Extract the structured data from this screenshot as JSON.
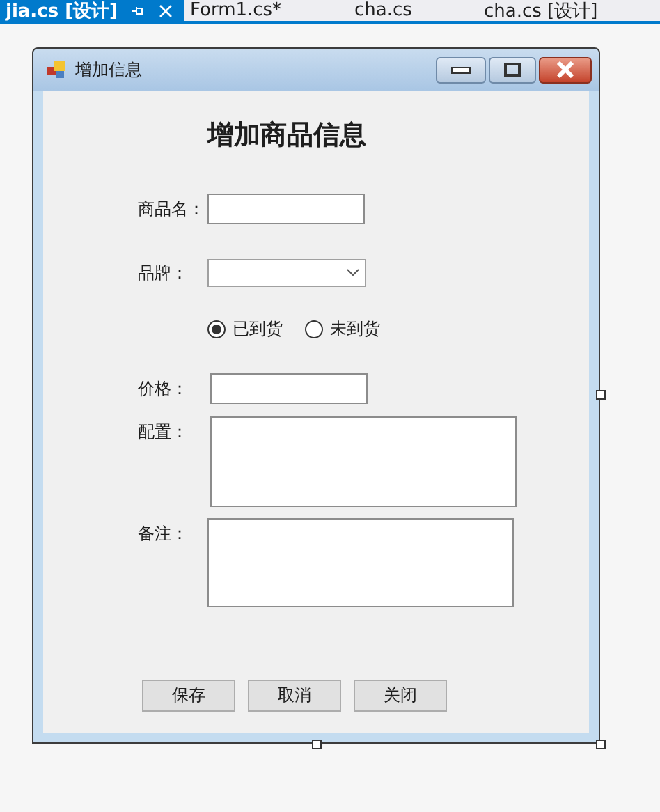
{
  "tabs": [
    {
      "label": "jia.cs [设计]",
      "selected": true
    },
    {
      "label": "Form1.cs*",
      "selected": false
    },
    {
      "label": "cha.cs",
      "selected": false
    },
    {
      "label": "cha.cs [设计]",
      "selected": false
    }
  ],
  "form": {
    "title": "增加信息",
    "heading": "增加商品信息",
    "fields": [
      {
        "kind": "text",
        "label": "商品名："
      },
      {
        "kind": "combo",
        "label": "品牌："
      },
      {
        "kind": "radio",
        "options": [
          {
            "label": "已到货",
            "selected": true
          },
          {
            "label": "未到货",
            "selected": false
          }
        ]
      },
      {
        "kind": "text",
        "label": "价格："
      },
      {
        "kind": "textarea",
        "label": "配置："
      },
      {
        "kind": "textarea",
        "label": "备注："
      }
    ],
    "buttons": [
      "保存",
      "取消",
      "关闭"
    ]
  }
}
